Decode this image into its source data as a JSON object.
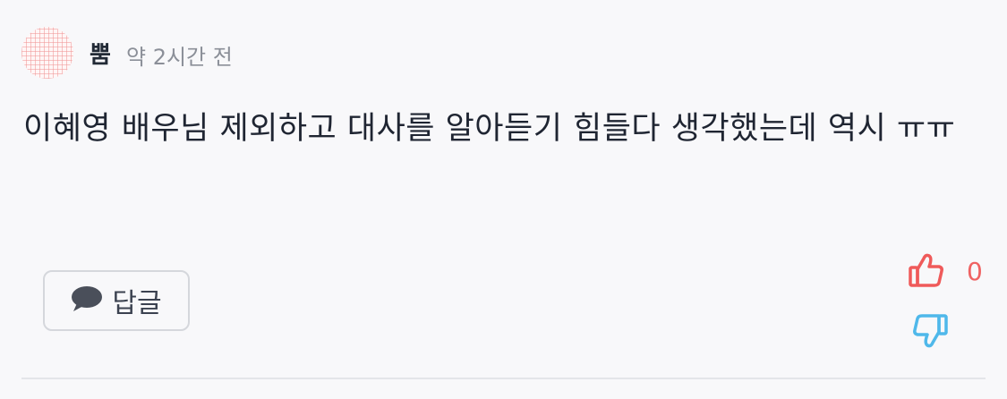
{
  "comment": {
    "author": "뿜",
    "time": "약 2시간 전",
    "text": "이혜영 배우님 제외하고 대사를 알아듣기 힘들다 생각했는데 역시 ㅠㅠ"
  },
  "actions": {
    "reply_label": "답글",
    "like_count": "0"
  },
  "colors": {
    "like": "#ef5a5a",
    "dislike": "#4fb8ea",
    "reply_icon": "#4a4f5a"
  },
  "icons": {
    "reply": "speech-bubble-icon",
    "like": "thumbs-up-icon",
    "dislike": "thumbs-down-icon"
  }
}
